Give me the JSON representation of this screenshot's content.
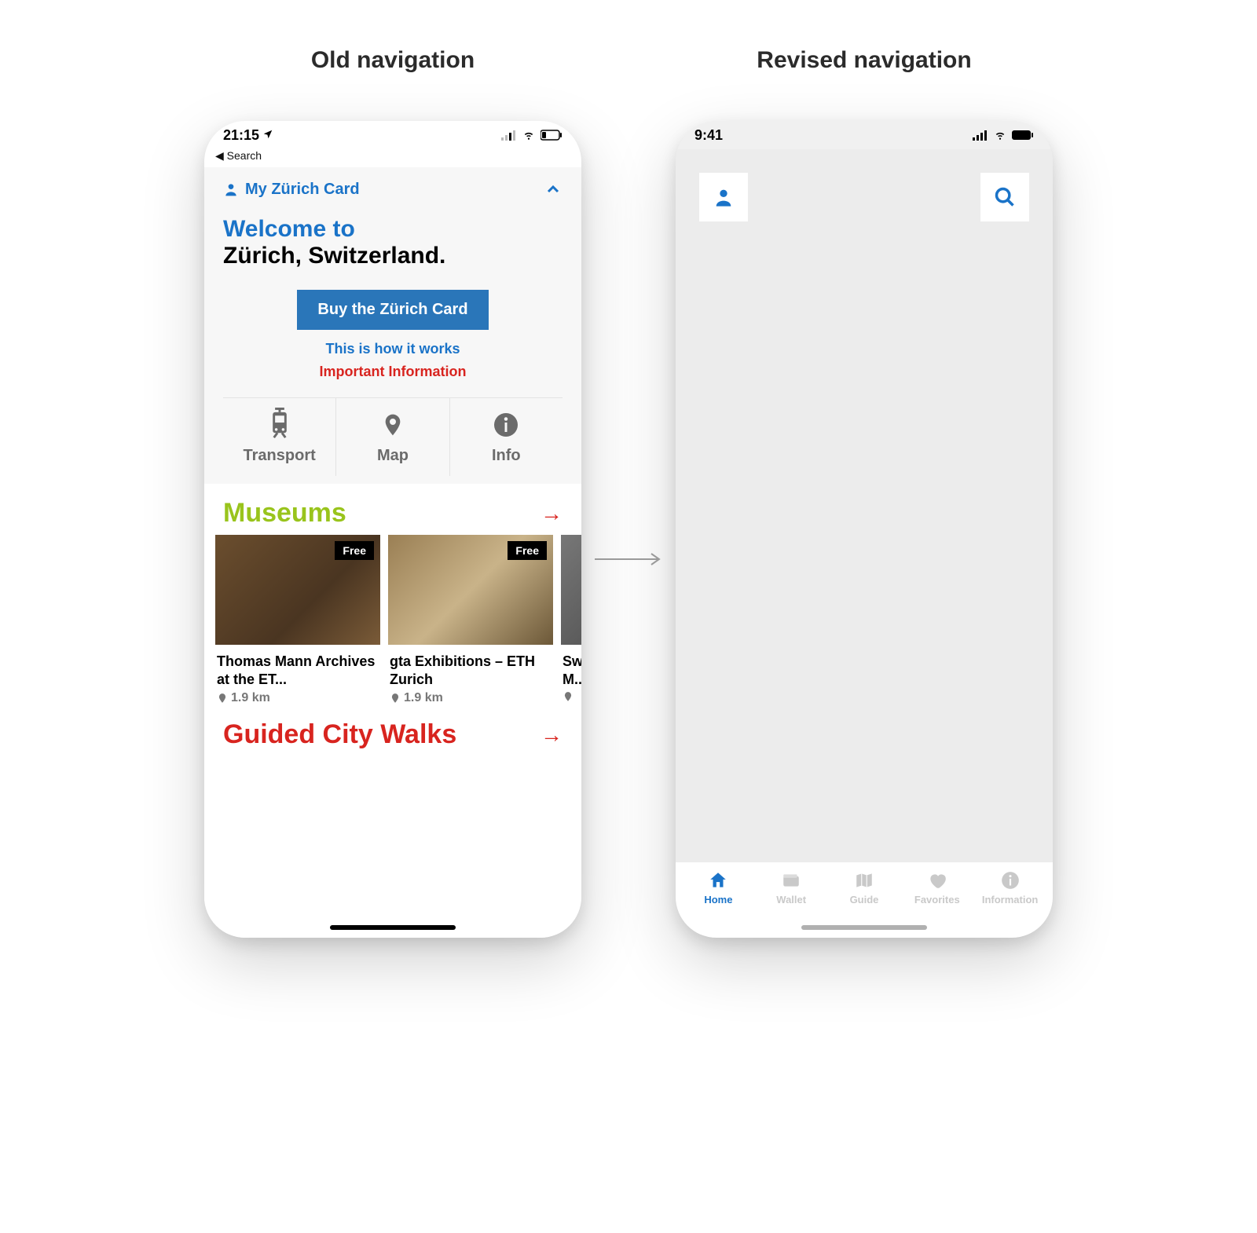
{
  "headings": {
    "old": "Old navigation",
    "revised": "Revised navigation"
  },
  "old": {
    "status_time": "21:15",
    "back_label": "Search",
    "my_card_label": "My Zürich Card",
    "welcome_line1": "Welcome to",
    "welcome_line2": "Zürich, Switzerland.",
    "buy_button": "Buy the Zürich Card",
    "how_link": "This is how it works",
    "important_link": "Important Information",
    "nav3": {
      "transport": "Transport",
      "map": "Map",
      "info": "Info"
    },
    "museums": {
      "title": "Museums",
      "items": [
        {
          "title": "Thomas Mann Archives at the ET...",
          "distance": "1.9 km",
          "badge": "Free"
        },
        {
          "title": "gta Exhibitions – ETH Zurich",
          "distance": "1.9 km",
          "badge": "Free"
        },
        {
          "title": "Sw M...",
          "distance": "",
          "badge": ""
        }
      ]
    },
    "walks_title": "Guided City Walks"
  },
  "revised": {
    "status_time": "9:41",
    "bottom_nav": [
      {
        "label": "Home",
        "icon": "home",
        "active": true
      },
      {
        "label": "Wallet",
        "icon": "wallet",
        "active": false
      },
      {
        "label": "Guide",
        "icon": "map",
        "active": false
      },
      {
        "label": "Favorites",
        "icon": "heart",
        "active": false
      },
      {
        "label": "Information",
        "icon": "info",
        "active": false
      }
    ]
  }
}
